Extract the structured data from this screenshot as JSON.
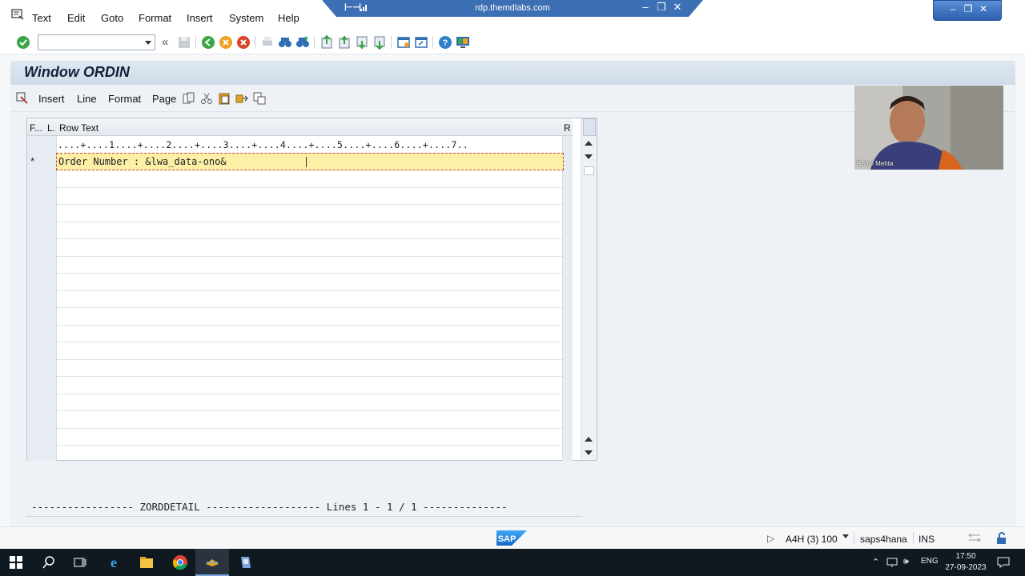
{
  "menubar": {
    "items": [
      "Text",
      "Edit",
      "Goto",
      "Format",
      "Insert",
      "System",
      "Help"
    ]
  },
  "rdp": {
    "host": "rdp.themdlabs.com"
  },
  "toolbar": {
    "command_field_value": ""
  },
  "screen": {
    "title": "Window ORDIN"
  },
  "app_toolbar": {
    "items": [
      "Insert",
      "Line",
      "Format",
      "Page"
    ]
  },
  "editor": {
    "columns": {
      "format": "F...",
      "line": "L.",
      "text": "Row Text",
      "r": "R"
    },
    "ruler": "....+....1....+....2....+....3....+....4....+....5....+....6....+....7..",
    "rows": [
      {
        "format": "*",
        "text": "Order Number : &lwa_data-ono&"
      }
    ]
  },
  "footer": {
    "summary": "----------------- ZORDDETAIL ------------------- Lines 1 - 1 / 1 --------------"
  },
  "webcam": {
    "participant": "Rahul Mehta"
  },
  "statusbar": {
    "logo": "SAP",
    "system": "A4H (3) 100",
    "server": "saps4hana",
    "mode": "INS"
  },
  "taskbar": {
    "language": "ENG",
    "time": "17:50",
    "date": "27-09-2023"
  },
  "colors": {
    "title_bg": "#d6e1ed",
    "active_row": "#fdf0a6",
    "accent": "#3d6fb5"
  }
}
